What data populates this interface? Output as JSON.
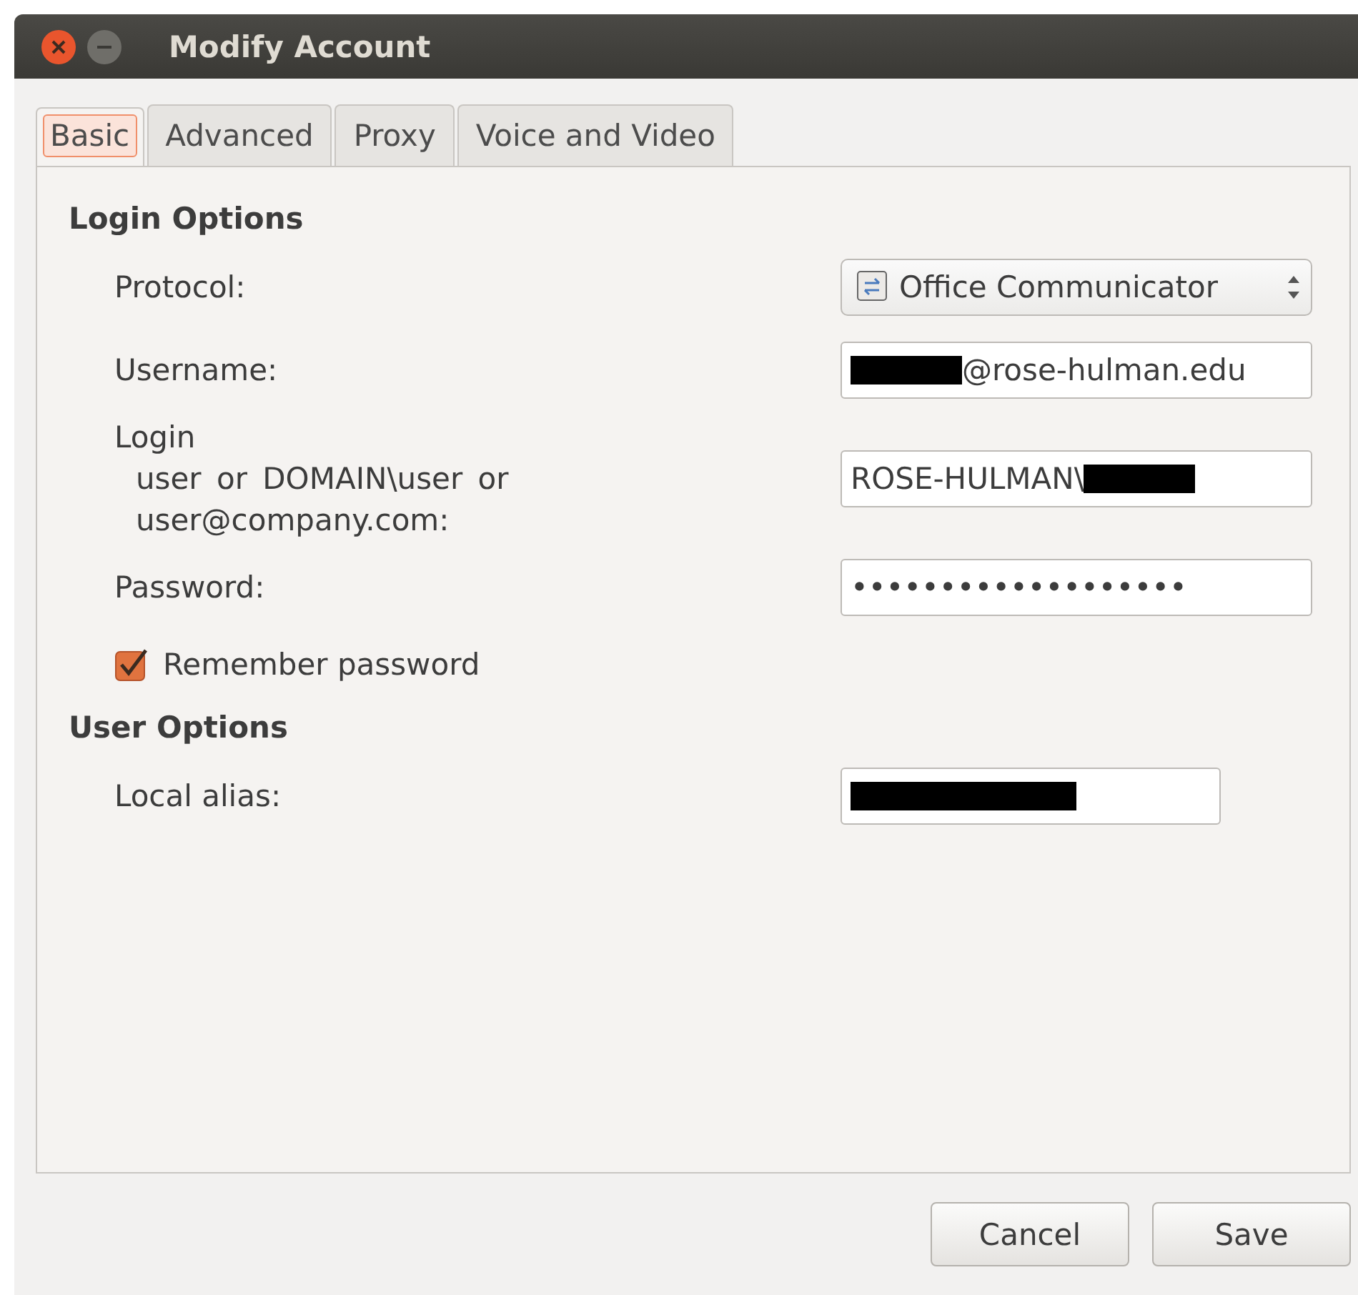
{
  "window": {
    "title": "Modify Account"
  },
  "tabs": [
    {
      "label": "Basic",
      "selected": true
    },
    {
      "label": "Advanced",
      "selected": false
    },
    {
      "label": "Proxy",
      "selected": false
    },
    {
      "label": "Voice and Video",
      "selected": false
    }
  ],
  "sections": [
    {
      "title": "Login Options",
      "rows": [
        {
          "kind": "select",
          "label": "Protocol:",
          "value": "Office Communicator"
        },
        {
          "kind": "field",
          "label": "Username:",
          "parts": [
            {
              "kind": "redacted"
            },
            {
              "kind": "text",
              "text": "@rose-hulman.edu"
            }
          ]
        },
        {
          "kind": "field",
          "label": "Login",
          "sublabel": "user or DOMAIN\\user or user@company.com:",
          "parts": [
            {
              "kind": "text",
              "text": "ROSE-HULMAN\\"
            },
            {
              "kind": "redacted"
            }
          ]
        },
        {
          "kind": "field",
          "label": "Password:",
          "parts": [
            {
              "kind": "text",
              "text": "•••••••••••••••••••"
            }
          ]
        },
        {
          "kind": "checkbox",
          "label": "Remember password",
          "checked": true
        }
      ]
    },
    {
      "title": "User Options",
      "rows": [
        {
          "kind": "field",
          "label": "Local alias:",
          "parts": [
            {
              "kind": "redacted"
            }
          ],
          "narrow": true
        }
      ]
    }
  ],
  "buttons": [
    "Cancel",
    "Save"
  ]
}
